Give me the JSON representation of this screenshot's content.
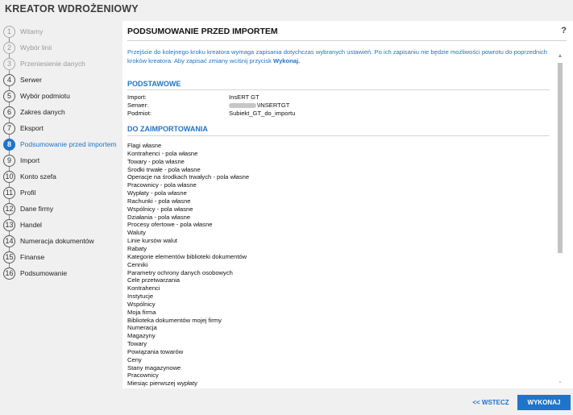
{
  "app": {
    "title": "KREATOR WDROŻENIOWY"
  },
  "sidebar": {
    "steps": [
      {
        "num": "1",
        "label": "Witamy"
      },
      {
        "num": "2",
        "label": "Wybór linii"
      },
      {
        "num": "3",
        "label": "Przeniesienie danych"
      },
      {
        "num": "4",
        "label": "Serwer"
      },
      {
        "num": "5",
        "label": "Wybór podmiotu"
      },
      {
        "num": "6",
        "label": "Zakres danych"
      },
      {
        "num": "7",
        "label": "Eksport"
      },
      {
        "num": "8",
        "label": "Podsumowanie przed importem"
      },
      {
        "num": "9",
        "label": "Import"
      },
      {
        "num": "10",
        "label": "Konto szefa"
      },
      {
        "num": "11",
        "label": "Profil"
      },
      {
        "num": "12",
        "label": "Dane firmy"
      },
      {
        "num": "13",
        "label": "Handel"
      },
      {
        "num": "14",
        "label": "Numeracja dokumentów"
      },
      {
        "num": "15",
        "label": "Finanse"
      },
      {
        "num": "16",
        "label": "Podsumowanie"
      }
    ]
  },
  "main": {
    "title": "PODSUMOWANIE PRZED IMPORTEM",
    "help": "?",
    "info_text": "Przejście do kolejnego kroku kreatora wymaga zapisania dotychczas wybranych ustawień. Po ich zapisaniu nie będzie możliwości powrotu do poprzednich kroków kreatora. Aby zapisać zmiany wciśnij przycisk ",
    "info_bold": "Wykonaj.",
    "basic": {
      "heading": "PODSTAWOWE",
      "rows": [
        {
          "key": "Import:",
          "value": "InsERT GT"
        },
        {
          "key": "Serwer:",
          "value": "\\INSERTGT"
        },
        {
          "key": "Podmiot:",
          "value": "Subiekt_GT_do_importu"
        }
      ]
    },
    "import_section": {
      "heading": "DO ZAIMPORTOWANIA",
      "items": [
        "Flagi własne",
        "Kontrahenci - pola własne",
        "Towary - pola własne",
        "Środki trwałe - pola własne",
        "Operacje na środkach trwałych - pola własne",
        "Pracownicy - pola własne",
        "Wypłaty - pola własne",
        "Rachunki - pola własne",
        "Wspólnicy - pola własne",
        "Działania - pola własne",
        "Procesy ofertowe - pola własne",
        "Waluty",
        "Linie kursów walut",
        "Rabaty",
        "Kategorie elementów biblioteki dokumentów",
        "Cenniki",
        "Parametry ochrony danych osobowych",
        "Cele przetwarzania",
        "Kontrahenci",
        "Instytucje",
        "Wspólnicy",
        "Moja firma",
        "Biblioteka dokumentów mojej firmy",
        "Numeracja",
        "Magazyny",
        "Towary",
        "Powiązania towarów",
        "Ceny",
        "Stany magazynowe",
        "Pracownicy",
        "Miesiąc pierwszej wypłaty"
      ]
    }
  },
  "footer": {
    "back_label": "<< WSTECZ",
    "execute_label": "WYKONAJ"
  }
}
